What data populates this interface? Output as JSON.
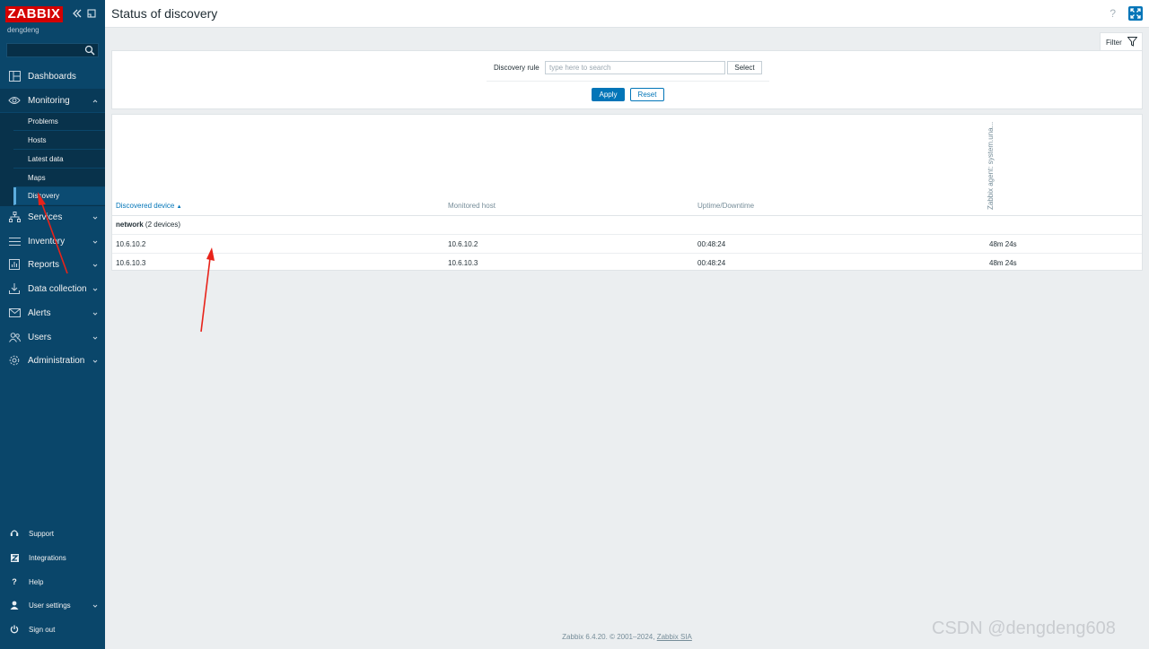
{
  "sidebar": {
    "logo": "ZABBIX",
    "username": "dengdeng",
    "search_placeholder": "",
    "menu": [
      {
        "label": "Dashboards",
        "icon": "dashboard-icon"
      },
      {
        "label": "Monitoring",
        "icon": "eye-icon",
        "expanded": true
      },
      {
        "label": "Services",
        "icon": "services-icon"
      },
      {
        "label": "Inventory",
        "icon": "list-icon"
      },
      {
        "label": "Reports",
        "icon": "report-icon"
      },
      {
        "label": "Data collection",
        "icon": "download-icon"
      },
      {
        "label": "Alerts",
        "icon": "envelope-icon"
      },
      {
        "label": "Users",
        "icon": "users-icon"
      },
      {
        "label": "Administration",
        "icon": "gear-icon"
      }
    ],
    "monitoring_submenu": [
      {
        "label": "Problems"
      },
      {
        "label": "Hosts"
      },
      {
        "label": "Latest data"
      },
      {
        "label": "Maps"
      },
      {
        "label": "Discovery",
        "active": true
      }
    ],
    "bottom": [
      {
        "label": "Support",
        "icon": "headset-icon"
      },
      {
        "label": "Integrations",
        "icon": "integrations-icon"
      },
      {
        "label": "Help",
        "icon": "question-icon"
      },
      {
        "label": "User settings",
        "icon": "user-icon"
      },
      {
        "label": "Sign out",
        "icon": "power-icon"
      }
    ]
  },
  "header": {
    "title": "Status of discovery",
    "help": "?"
  },
  "filter": {
    "tab_label": "Filter",
    "rule_label": "Discovery rule",
    "rule_placeholder": "type here to search",
    "select_label": "Select",
    "apply_label": "Apply",
    "reset_label": "Reset"
  },
  "table": {
    "columns": [
      "Discovered device",
      "Monitored host",
      "Uptime/Downtime",
      "Zabbix agent: system.una..."
    ],
    "sort_indicator": "▲",
    "group": {
      "name": "network",
      "count": "(2 devices)"
    },
    "rows": [
      {
        "device": "10.6.10.2",
        "host": "10.6.10.2",
        "uptime": "00:48:24",
        "agent": "48m 24s"
      },
      {
        "device": "10.6.10.3",
        "host": "10.6.10.3",
        "uptime": "00:48:24",
        "agent": "48m 24s"
      }
    ]
  },
  "footer": {
    "text": "Zabbix 6.4.20. © 2001–2024,",
    "link": "Zabbix SIA"
  },
  "watermark": "CSDN @dengdeng608",
  "colors": {
    "sidebar_bg": "#0a466a",
    "logo_red": "#d40000",
    "accent_blue": "#0275b8",
    "annotation_red": "#e8231a"
  }
}
